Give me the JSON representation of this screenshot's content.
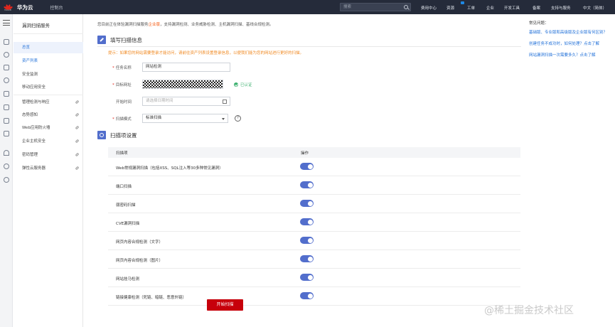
{
  "topbar": {
    "brand": "华为云",
    "logo_text": "HUAWEI",
    "console": "控制台",
    "search_placeholder": "搜索",
    "nav": [
      "费用中心",
      "资源",
      "工单",
      "企业",
      "开发工具",
      "备案",
      "支持与服务",
      "中文（简体）"
    ]
  },
  "sidebar": {
    "title": "漏洞扫描服务",
    "items": [
      {
        "label": "总览"
      },
      {
        "label": "资产列表"
      },
      {
        "label": "安全监测"
      },
      {
        "label": "移动应用安全"
      },
      {
        "label": "管理检测与响应"
      },
      {
        "label": "态势感知"
      },
      {
        "label": "Web应用防火墙"
      },
      {
        "label": "企业主机安全"
      },
      {
        "label": "密码管理"
      },
      {
        "label": "弹性云服务器"
      }
    ]
  },
  "intro": {
    "before": "您目前正在体验漏洞扫描服务",
    "highlight": "企业版",
    "after": "，支持漏洞检测、业务威胁检测、主机漏洞扫描、基线合规检测。"
  },
  "section1": {
    "title": "填写扫描信息"
  },
  "tip": "提示：如果您的网站需要登录才能访问，请前往资产列表设置登录信息，以便我们能为您的网站进行更好的扫描。",
  "form": {
    "task_name_label": "任务名称",
    "task_name_value": "网站检测",
    "target_label": "目标网址",
    "verified_label": "已认证",
    "start_time_label": "开始时间",
    "start_time_placeholder": "请选择日期时间",
    "mode_label": "扫描模式",
    "mode_value": "标准扫描",
    "help_glyph": "?"
  },
  "section2": {
    "title": "扫描项设置"
  },
  "table": {
    "col_item": "扫描项",
    "col_op": "操作",
    "rows": [
      {
        "label": "Web常规漏洞扫描（包括XSS、SQL注入等30多种常见漏洞）",
        "enabled": true
      },
      {
        "label": "端口扫描",
        "enabled": true
      },
      {
        "label": "弱密码扫描",
        "enabled": true
      },
      {
        "label": "CVE漏洞扫描",
        "enabled": true
      },
      {
        "label": "网页内容合规检测（文字）",
        "enabled": true
      },
      {
        "label": "网页内容合规检测（图片）",
        "enabled": true
      },
      {
        "label": "网站挂马检测",
        "enabled": true
      },
      {
        "label": "链接健康检测（死链、暗链、恶意外链）",
        "enabled": true
      }
    ]
  },
  "start_button": "开始扫描",
  "faq": {
    "title": "常见问题：",
    "links": [
      "基础版、专业版和高级版及企业版有何区别？",
      "创建任务不成功时，如何处理？点击了解",
      "网站漏洞扫描一次需要多久？点击了解"
    ]
  },
  "watermark": "@稀土掘金技术社区",
  "colors": {
    "accent": "#526ecc",
    "primary_button": "#c7000b",
    "topbar": "#252b3a",
    "warning": "#f08a24",
    "link": "#1f6fd8"
  }
}
